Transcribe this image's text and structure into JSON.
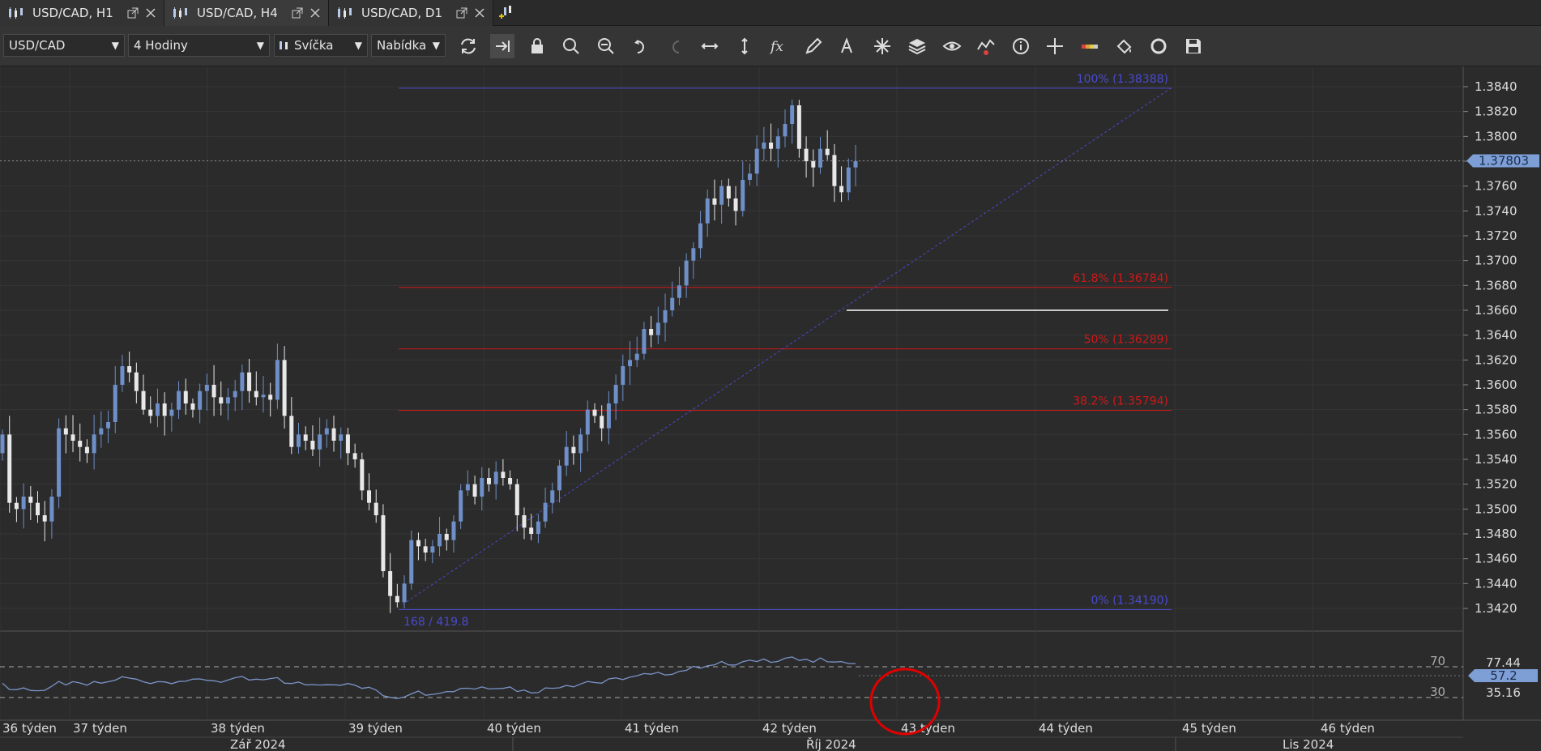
{
  "tabs": [
    {
      "label": "USD/CAD, H1",
      "active": false
    },
    {
      "label": "USD/CAD, H4",
      "active": true
    },
    {
      "label": "USD/CAD, D1",
      "active": false
    }
  ],
  "toolbar": {
    "symbol": "USD/CAD",
    "timeframe": "4 Hodiny",
    "chart_type": "Svíčka",
    "price_type": "Nabídka",
    "icons": [
      "refresh-icon",
      "auto-scroll-icon",
      "lock-icon",
      "zoom-in-icon",
      "zoom-out-icon",
      "undo-icon",
      "redo-icon",
      "fit-horizontal-icon",
      "fit-vertical-icon",
      "indicators-icon",
      "drawing-pencil-icon",
      "text-tool-icon",
      "crosshair-icon",
      "layers-icon",
      "visibility-icon",
      "alerts-icon",
      "info-icon",
      "cursor-icon",
      "color-scheme-icon",
      "fill-icon",
      "sync-icon",
      "save-icon"
    ]
  },
  "colors": {
    "background": "#2b2b2b",
    "bull_candle": "#6e8fc7",
    "bear_candle": "#e8e8e8",
    "fib_blue": "#4a4ad0",
    "fib_red": "#d01818",
    "rsi_line": "#7a94c8",
    "price_badge": "#7d9fd6",
    "highlight_circle": "#e00000"
  },
  "price_axis": {
    "ticks": [
      "1.3840",
      "1.3820",
      "1.3800",
      "1.3780",
      "1.3760",
      "1.3740",
      "1.3720",
      "1.3700",
      "1.3680",
      "1.3660",
      "1.3640",
      "1.3620",
      "1.3600",
      "1.3580",
      "1.3560",
      "1.3540",
      "1.3520",
      "1.3500",
      "1.3480",
      "1.3460",
      "1.3440",
      "1.3420"
    ],
    "current_price": "1.37803"
  },
  "fibonacci": {
    "levels": [
      {
        "label": "100% (1.38388)",
        "price": 1.38388,
        "color": "blue"
      },
      {
        "label": "61.8% (1.36784)",
        "price": 1.36784,
        "color": "red"
      },
      {
        "label": "50% (1.36289)",
        "price": 1.36289,
        "color": "red"
      },
      {
        "label": "38.2% (1.35794)",
        "price": 1.35794,
        "color": "red"
      },
      {
        "label": "0% (1.34190)",
        "price": 1.3419,
        "color": "blue"
      }
    ],
    "measure_label": "168 / 419.8"
  },
  "horizontal_line_price": 1.366,
  "rsi": {
    "levels": [
      "70",
      "30"
    ],
    "max_label": "77.44",
    "current": "57.2",
    "min_label": "35.16"
  },
  "time_axis": {
    "weeks": [
      "36 týden",
      "37 týden",
      "38 týden",
      "39 týden",
      "40 týden",
      "41 týden",
      "42 týden",
      "43 týden",
      "44 týden",
      "45 týden",
      "46 týden"
    ],
    "months": [
      "Zář 2024",
      "Říj 2024",
      "Lis 2024"
    ]
  },
  "chart_data": {
    "type": "candlestick",
    "symbol": "USD/CAD",
    "timeframe": "H4",
    "ylim": [
      1.3405,
      1.3855
    ],
    "closes": [
      1.356,
      1.3505,
      1.35,
      1.351,
      1.3505,
      1.3495,
      1.349,
      1.351,
      1.3565,
      1.356,
      1.3555,
      1.355,
      1.3545,
      1.356,
      1.3565,
      1.357,
      1.36,
      1.3615,
      1.361,
      1.3595,
      1.358,
      1.3575,
      1.3585,
      1.3575,
      1.358,
      1.3595,
      1.3585,
      1.358,
      1.3595,
      1.36,
      1.359,
      1.3585,
      1.359,
      1.3595,
      1.361,
      1.3595,
      1.359,
      1.3592,
      1.3588,
      1.362,
      1.3575,
      1.355,
      1.356,
      1.3555,
      1.3548,
      1.356,
      1.3565,
      1.3555,
      1.356,
      1.3545,
      1.354,
      1.3515,
      1.3505,
      1.3495,
      1.345,
      1.343,
      1.3425,
      1.344,
      1.3475,
      1.347,
      1.3465,
      1.347,
      1.348,
      1.3475,
      1.349,
      1.3515,
      1.352,
      1.351,
      1.3525,
      1.352,
      1.353,
      1.3525,
      1.352,
      1.3495,
      1.3485,
      1.348,
      1.349,
      1.3505,
      1.3515,
      1.3535,
      1.355,
      1.3545,
      1.356,
      1.358,
      1.3575,
      1.3565,
      1.3585,
      1.36,
      1.3615,
      1.362,
      1.3625,
      1.3645,
      1.364,
      1.365,
      1.366,
      1.367,
      1.368,
      1.37,
      1.371,
      1.373,
      1.375,
      1.3745,
      1.376,
      1.375,
      1.374,
      1.3765,
      1.377,
      1.379,
      1.3795,
      1.379,
      1.38,
      1.381,
      1.3825,
      1.379,
      1.378,
      1.3775,
      1.379,
      1.3785,
      1.376,
      1.3755,
      1.3775,
      1.378
    ]
  }
}
